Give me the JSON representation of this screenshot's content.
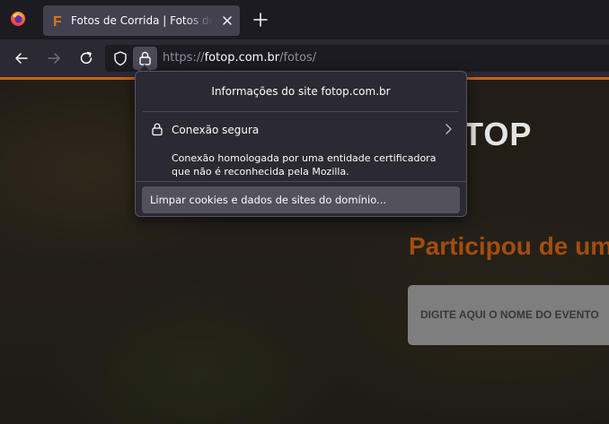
{
  "browser": {
    "logo_icon": "firefox-logo-icon",
    "tab": {
      "favicon_letter": "F",
      "title": "Fotos de Corrida | Fotos de Maratona",
      "close_icon": "close-icon"
    },
    "new_tab_icon": "plus-icon",
    "nav": {
      "back_icon": "arrow-left-icon",
      "forward_icon": "arrow-right-icon",
      "reload_icon": "reload-icon",
      "shield_icon": "shield-icon",
      "lock_icon": "lock-icon"
    },
    "url": {
      "scheme": "https://",
      "host": "fotop.com.br",
      "path": "/fotos/"
    },
    "accent_color": "#c4641b"
  },
  "site_info_popup": {
    "title": "Informações do site fotop.com.br",
    "connection_label": "Conexão segura",
    "connection_description": "Conexão homologada por uma entidade certificadora que não é reconhecida pela Mozilla.",
    "clear_button": "Limpar cookies e dados de sites do domínio..."
  },
  "page": {
    "logo_text": "TOP",
    "headline": "Participou de um evento?",
    "search_placeholder": "DIGITE AQUI O NOME DO EVENTO",
    "headline_color": "#a34d10"
  }
}
